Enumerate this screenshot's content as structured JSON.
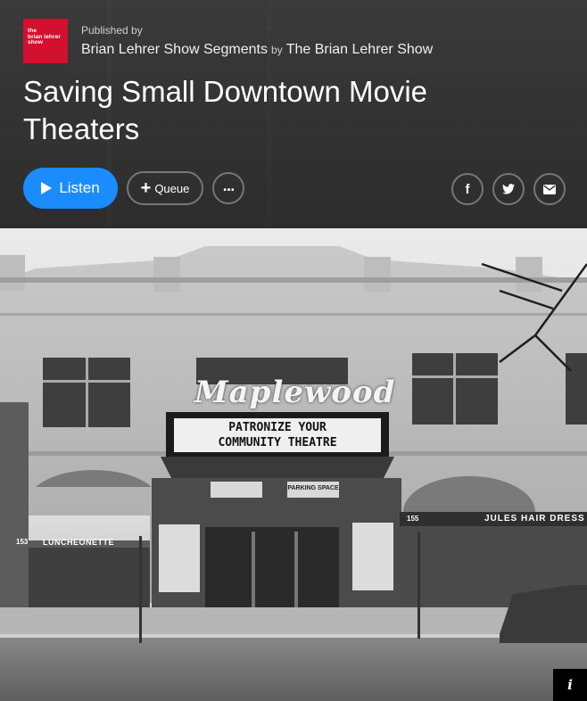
{
  "header": {
    "show_logo_lines": [
      "the",
      "brian lehrer",
      "show"
    ],
    "published_label": "Published by",
    "publisher_name": "Brian Lehrer Show Segments",
    "by_label": "by",
    "show_name": "The Brian Lehrer Show",
    "title": "Saving Small Downtown Movie Theaters"
  },
  "actions": {
    "listen_label": "Listen",
    "queue_label": "Queue",
    "more_label": "..."
  },
  "share": {
    "facebook_glyph": "f"
  },
  "photo": {
    "marquee_sign": "Maplewood",
    "marquee_line1": "PATRONIZE YOUR",
    "marquee_line2": "COMMUNITY THEATRE",
    "left_shop_sign": "LUNCHEONETTE",
    "left_shop_number": "153",
    "right_shop_sign": "JULES HAIR DRESS",
    "right_shop_number": "155",
    "parking_sign": "PARKING SPACE",
    "info_glyph": "i"
  },
  "colors": {
    "listen_blue": "#1a8cff",
    "logo_red": "#d3102e"
  }
}
